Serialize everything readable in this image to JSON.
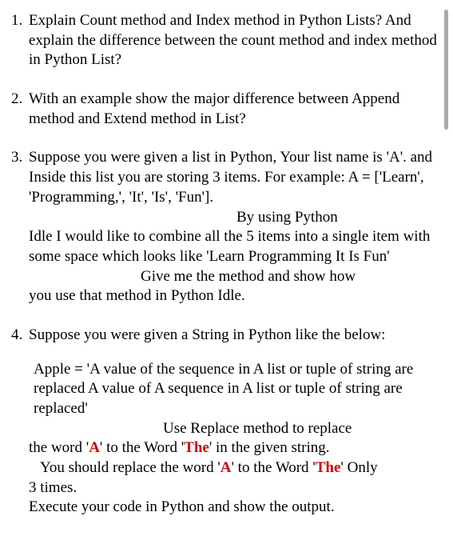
{
  "questions": {
    "q1": {
      "num": "1.",
      "text": "Explain Count method and Index method in Python Lists? And explain the difference between the count method and index method in Python List?"
    },
    "q2": {
      "num": "2.",
      "text": "With an example show the major difference between Append method and Extend method in List?"
    },
    "q3": {
      "num": "3.",
      "p1": "Suppose you were given a list in Python, Your list name is 'A'. and Inside this list you are storing 3 items. For example: A = ['Learn', 'Programming,', 'It', 'Is', 'Fun'].",
      "p2_right": "By using Python",
      "p3": "Idle I would like to combine all the 5 items into a single item with some space which looks like 'Learn Programming It Is Fun'",
      "p4_mid": "Give me the method and show how",
      "p5": "you use that method in Python Idle."
    },
    "q4": {
      "num": "4.",
      "p1": "Suppose you were given a String in Python like the below:",
      "p2": "Apple = 'A value of the sequence in A list or tuple of string are replaced A value of A sequence in A list or tuple of string are replaced'",
      "p3_mid": "Use Replace method to replace",
      "p4_a": "the word '",
      "p4_b": "' to the Word '",
      "p4_c": "' in the given string.",
      "p5_a": "You should replace the word '",
      "p5_b": "' to the Word '",
      "p5_c": "' Only",
      "p6": "3 times.",
      "p7": "Execute your code in Python and show the output.",
      "word_a": "A",
      "word_the": "The"
    }
  }
}
